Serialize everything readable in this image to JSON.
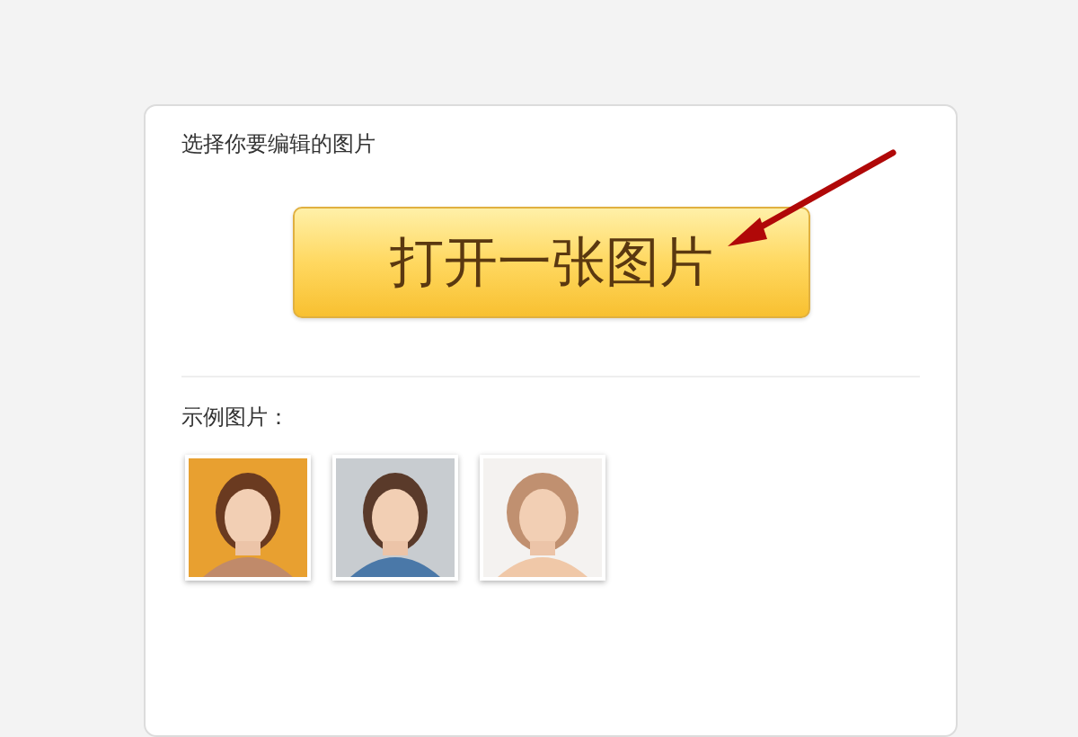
{
  "card": {
    "title": "选择你要编辑的图片",
    "open_button": "打开一张图片",
    "examples_label": "示例图片："
  }
}
